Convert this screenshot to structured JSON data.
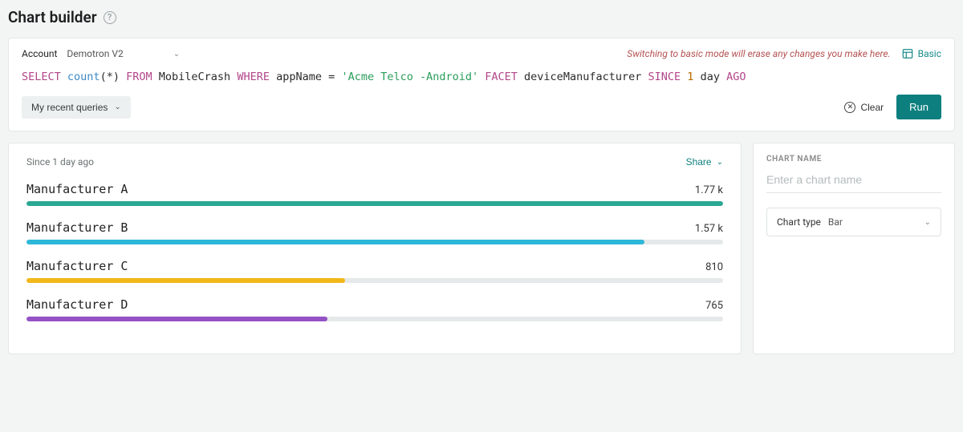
{
  "header": {
    "title": "Chart builder"
  },
  "query": {
    "account_label": "Account",
    "account_value": "Demotron V2",
    "warning": "Switching to basic mode will erase any changes you make here.",
    "basic_link": "Basic",
    "tokens": {
      "select": "SELECT",
      "count": "count",
      "paren_open": "(",
      "star": "*",
      "paren_close": ")",
      "from": "FROM",
      "table": "MobileCrash",
      "where": "WHERE",
      "field": "appName",
      "eq": "=",
      "str": "'Acme Telco -Android'",
      "facet": "FACET",
      "facet_field": "deviceManufacturer",
      "since": "SINCE",
      "num": "1",
      "unit": "day",
      "ago": "AGO"
    },
    "recent_label": "My recent queries",
    "clear_label": "Clear",
    "run_label": "Run"
  },
  "chart": {
    "timeframe": "Since 1 day ago",
    "share_label": "Share"
  },
  "sidebar": {
    "chart_name_label": "CHART NAME",
    "chart_name_placeholder": "Enter a chart name",
    "chart_type_label": "Chart type",
    "chart_type_value": "Bar"
  },
  "chart_data": {
    "type": "bar",
    "orientation": "horizontal",
    "title": "",
    "xlabel": "",
    "ylabel": "",
    "max": 1770,
    "series": [
      {
        "name": "Manufacturer A",
        "value": 1770,
        "display": "1.77 k",
        "color": "#2aa893"
      },
      {
        "name": "Manufacturer B",
        "value": 1570,
        "display": "1.57 k",
        "color": "#2db7d9"
      },
      {
        "name": "Manufacturer C",
        "value": 810,
        "display": "810",
        "color": "#f2b719"
      },
      {
        "name": "Manufacturer D",
        "value": 765,
        "display": "765",
        "color": "#9452c4"
      }
    ]
  }
}
